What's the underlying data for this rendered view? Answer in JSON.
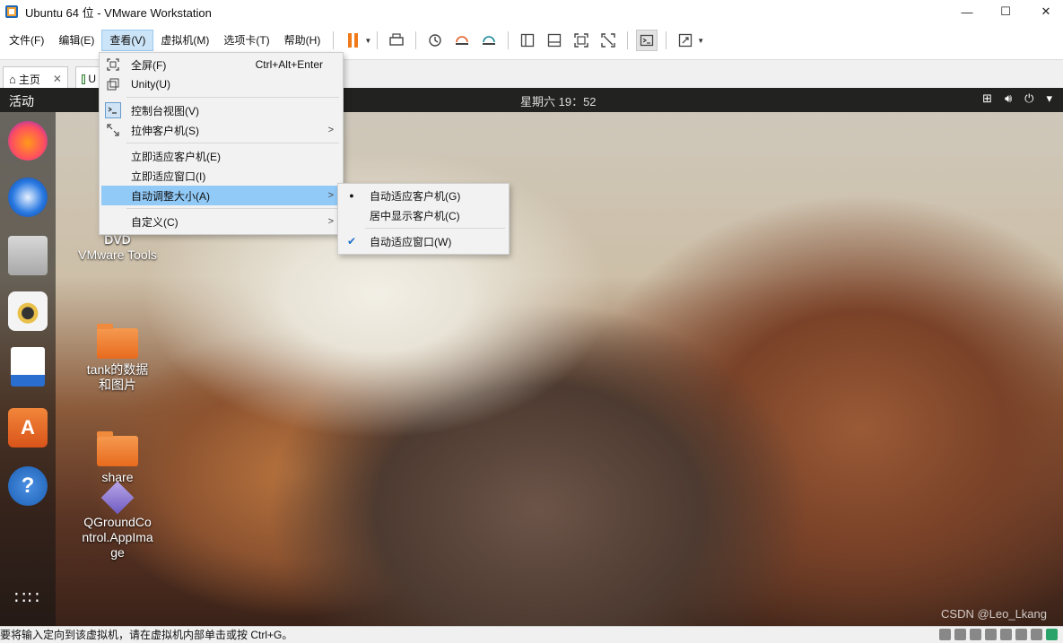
{
  "window": {
    "title": "Ubuntu 64 位 - VMware Workstation"
  },
  "window_controls": {
    "minimize": "—",
    "maximize": "☐",
    "close": "✕"
  },
  "menubar": {
    "items": [
      "文件(F)",
      "编辑(E)",
      "查看(V)",
      "虚拟机(M)",
      "选项卡(T)",
      "帮助(H)"
    ],
    "active": "查看(V)"
  },
  "tabs": {
    "home": "主页",
    "vm_tab": "U"
  },
  "view_menu": {
    "fullscreen": {
      "label": "全屏(F)",
      "shortcut": "Ctrl+Alt+Enter",
      "icon": "fullscreen-icon"
    },
    "unity": {
      "label": "Unity(U)",
      "icon": "unity-icon"
    },
    "console_view": {
      "label": "控制台视图(V)",
      "icon": "console-icon"
    },
    "stretch_guest": {
      "label": "拉伸客户机(S)",
      "icon": "stretch-icon"
    },
    "fit_guest_now": {
      "label": "立即适应客户机(E)"
    },
    "fit_window_now": {
      "label": "立即适应窗口(I)"
    },
    "autosize": {
      "label": "自动调整大小(A)"
    },
    "customize": {
      "label": "自定义(C)"
    }
  },
  "autosize_submenu": {
    "auto_fit_guest": {
      "label": "自动适应客户机(G)",
      "marker": "●"
    },
    "center_guest": {
      "label": "居中显示客户机(C)"
    },
    "auto_fit_window": {
      "label": "自动适应窗口(W)",
      "marker": "✔"
    }
  },
  "guest": {
    "activities": "活动",
    "clock": "星期六 19：52",
    "desktop_icons": [
      {
        "label": "VMware Tools",
        "icon": "dvd-icon"
      },
      {
        "label": "tank的数据和图片",
        "icon": "folder-icon"
      },
      {
        "label": "share",
        "icon": "folder-icon"
      },
      {
        "label": "QGroundControl.AppImage",
        "icon": "appimage-icon"
      }
    ],
    "dock_icons": [
      "firefox-icon",
      "thunderbird-icon",
      "files-icon",
      "rhythmbox-icon",
      "writer-icon",
      "software-icon",
      "help-icon",
      "apps-grid-icon"
    ]
  },
  "statusbar": {
    "text": "要将输入定向到该虚拟机，请在虚拟机内部单击或按 Ctrl+G。"
  },
  "watermark": "CSDN @Leo_Lkang",
  "colors": {
    "highlight": "#91c9f7",
    "menu_active": "#cce4f7",
    "pause": "#f07a1a"
  }
}
